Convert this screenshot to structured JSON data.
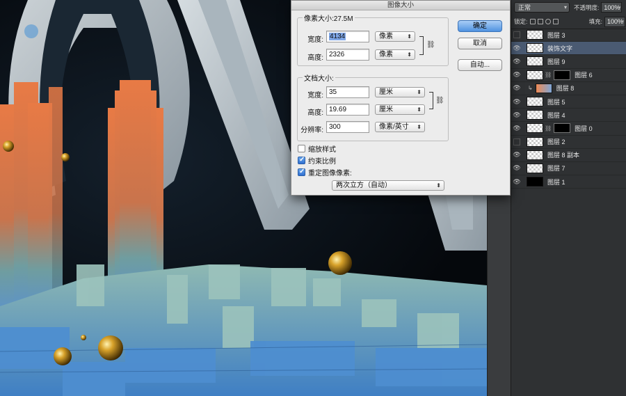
{
  "dialog": {
    "title": "图像大小",
    "pixel_group_title": "像素大小:27.5M",
    "width_label": "宽度:",
    "width_value": "4134",
    "width_unit": "像素",
    "height_label": "高度:",
    "height_value": "2326",
    "height_unit": "像素",
    "doc_group_title": "文档大小:",
    "doc_width_label": "宽度:",
    "doc_width_value": "35",
    "doc_width_unit": "厘米",
    "doc_height_label": "高度:",
    "doc_height_value": "19.69",
    "doc_height_unit": "厘米",
    "resolution_label": "分辨率:",
    "resolution_value": "300",
    "resolution_unit": "像素/英寸",
    "scale_styles_label": "缩放样式",
    "scale_styles_checked": false,
    "constrain_label": "约束比例",
    "constrain_checked": true,
    "resample_label": "重定图像像素:",
    "resample_checked": true,
    "resample_method": "两次立方（自动）",
    "ok_label": "确定",
    "cancel_label": "取消",
    "auto_label": "自动..."
  },
  "panel": {
    "blend_mode": "正常",
    "opacity_label": "不透明度:",
    "opacity_value": "100%",
    "lock_label": "锁定:",
    "fill_label": "填充:",
    "fill_value": "100%",
    "layers": [
      {
        "name": "图层 3",
        "visible": false,
        "thumb": "checker"
      },
      {
        "name": "装饰文字",
        "visible": true,
        "thumb": "checker",
        "selected": true
      },
      {
        "name": "图层 9",
        "visible": true,
        "thumb": "checker"
      },
      {
        "name": "图层 6",
        "visible": true,
        "thumb": "checker",
        "mask": true
      },
      {
        "name": "图层 8",
        "visible": true,
        "thumb": "gradient",
        "clipped": true
      },
      {
        "name": "图层 5",
        "visible": true,
        "thumb": "checker"
      },
      {
        "name": "图层 4",
        "visible": true,
        "thumb": "checker"
      },
      {
        "name": "图层 0",
        "visible": true,
        "thumb": "checker",
        "mask": true
      },
      {
        "name": "图层 2",
        "visible": false,
        "thumb": "checker"
      },
      {
        "name": "图层 8 副本",
        "visible": true,
        "thumb": "checker"
      },
      {
        "name": "图层 7",
        "visible": true,
        "thumb": "checker"
      },
      {
        "name": "图层 1",
        "visible": true,
        "thumb": "black"
      }
    ]
  },
  "colors": {
    "orange": "#e2784a",
    "blue": "#5d93c8",
    "letter_face": "#b9c3ca",
    "sphere": "#d8a22a",
    "accent_button": "#4f92e0"
  }
}
